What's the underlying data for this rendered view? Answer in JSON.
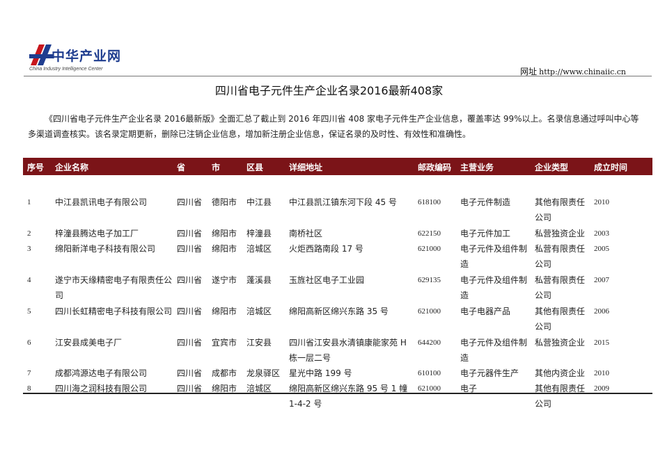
{
  "header": {
    "logo_name": "中华产业网",
    "logo_subtitle": "China Industry Intelligence Center",
    "site_label": "网址",
    "site_url": "http://www.chinaiic.cn",
    "brand_colors": {
      "logo_blue": "#1f3d8f",
      "logo_red": "#c8161d",
      "table_header": "#7b1418"
    }
  },
  "document": {
    "title": "四川省电子元件生产企业名录2016最新408家",
    "intro": "《四川省电子元件生产企业名录 2016最新版》全面汇总了截止到 2016 年四川省 408 家电子元件生产企业信息，覆盖率达 99%以上。名录信息通过呼叫中心等多渠道调查核实。该名录定期更新，删除已注销企业信息，增加新注册企业信息，保证名录的及时性、有效性和准确性。"
  },
  "table": {
    "headers": {
      "seq": "序号",
      "name": "企业名称",
      "province": "省",
      "city": "市",
      "district": "区县",
      "address": "详细地址",
      "zip": "邮政编码",
      "business": "主营业务",
      "type": "企业类型",
      "year": "成立时间"
    },
    "rows": [
      {
        "seq": "1",
        "name": "中江县凯讯电子有限公司",
        "province": "四川省",
        "city": "德阳市",
        "district": "中江县",
        "address": "中江县凯江镇东河下段 45 号",
        "zip": "618100",
        "business": "电子元件制造",
        "type": "其他有限责任公司",
        "year": "2010"
      },
      {
        "seq": "2",
        "name": "梓潼县腾达电子加工厂",
        "province": "四川省",
        "city": "绵阳市",
        "district": "梓潼县",
        "address": "南桥社区",
        "zip": "622150",
        "business": "电子元件加工",
        "type": "私营独资企业",
        "year": "2003"
      },
      {
        "seq": "3",
        "name": "绵阳新洋电子科技有限公司",
        "province": "四川省",
        "city": "绵阳市",
        "district": "涪城区",
        "address": "火炬西路南段 17 号",
        "zip": "621000",
        "business": "电子元件及组件制造",
        "type": "私营有限责任公司",
        "year": "2005"
      },
      {
        "seq": "4",
        "name": "遂宁市天缘精密电子有限责任公司",
        "province": "四川省",
        "city": "遂宁市",
        "district": "蓬溪县",
        "address": "玉旌社区电子工业园",
        "zip": "629135",
        "business": "电子元件及组件制造",
        "type": "私营有限责任公司",
        "year": "2007"
      },
      {
        "seq": "5",
        "name": "四川长虹精密电子科技有限公司",
        "province": "四川省",
        "city": "绵阳市",
        "district": "涪城区",
        "address": "绵阳高新区绵兴东路 35 号",
        "zip": "621000",
        "business": "电子电器产品",
        "type": "其他有限责任公司",
        "year": "2006"
      },
      {
        "seq": "6",
        "name": "江安县成美电子厂",
        "province": "四川省",
        "city": "宜宾市",
        "district": "江安县",
        "address": "四川省江安县水清镇康能家苑 H 栋一层二号",
        "zip": "644200",
        "business": "电子元件及组件制造",
        "type": "私营独资企业",
        "year": "2015"
      },
      {
        "seq": "7",
        "name": "成都鸿源达电子有限公司",
        "province": "四川省",
        "city": "成都市",
        "district": "龙泉驿区",
        "address": "星光中路 199 号",
        "zip": "610100",
        "business": "电子元器件生产",
        "type": "其他内资企业",
        "year": "2010"
      },
      {
        "seq": "8",
        "name": "四川海之润科技有限公司",
        "province": "四川省",
        "city": "绵阳市",
        "district": "涪城区",
        "address": "绵阳高新区绵兴东路 95 号 1 幢 1-4-2 号",
        "zip": "621000",
        "business": "电子",
        "type": "其他有限责任公司",
        "year": "2009"
      }
    ]
  }
}
